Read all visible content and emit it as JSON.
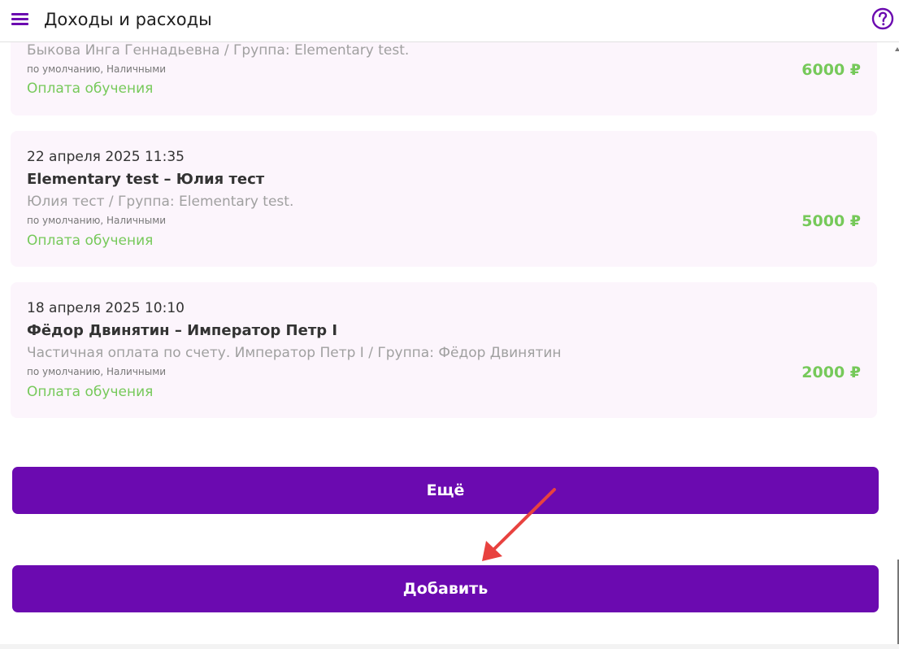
{
  "header": {
    "title": "Доходы и расходы"
  },
  "transactions": [
    {
      "date": "",
      "title": "",
      "description": "Быкова Инга Геннадьевна  / Группа: Elementary test.",
      "meta": "по умолчанию, Наличными",
      "category": "Оплата обучения",
      "amount": "6000 ₽"
    },
    {
      "date": "22 апреля 2025 11:35",
      "title": "Elementary test – Юлия тест",
      "description": "Юлия тест / Группа: Elementary test.",
      "meta": "по умолчанию, Наличными",
      "category": "Оплата обучения",
      "amount": "5000 ₽"
    },
    {
      "date": "18 апреля 2025 10:10",
      "title": "Фёдор Двинятин – Император Петр I",
      "description": "Частичная оплата по счету. Император Петр I / Группа: Фёдор Двинятин",
      "meta": "по умолчанию, Наличными",
      "category": "Оплата обучения",
      "amount": "2000 ₽"
    }
  ],
  "buttons": {
    "more_label": "Ещё",
    "add_label": "Добавить"
  },
  "icons": {
    "menu": "hamburger-menu-icon",
    "help": "question-circle-icon",
    "annotation": "red-arrow"
  },
  "colors": {
    "accent": "#6b0ab0",
    "income": "#76c95a",
    "card_bg": "#fcf5fc",
    "annotation": "#e8423f"
  }
}
